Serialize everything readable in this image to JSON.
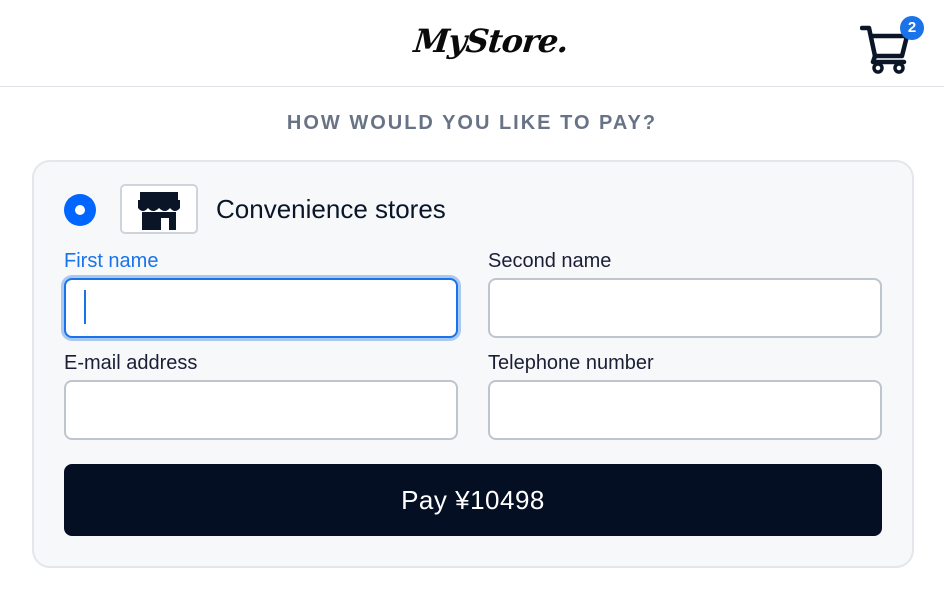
{
  "header": {
    "logo_text": "MyStore.",
    "cart_count": "2"
  },
  "page": {
    "heading": "HOW WOULD YOU LIKE TO PAY?"
  },
  "payment_method": {
    "label": "Convenience stores",
    "selected": true,
    "icon": "storefront-icon"
  },
  "form": {
    "first_name": {
      "label": "First name",
      "value": ""
    },
    "second_name": {
      "label": "Second name",
      "value": ""
    },
    "email": {
      "label": "E-mail address",
      "value": ""
    },
    "telephone": {
      "label": "Telephone number",
      "value": ""
    }
  },
  "pay_button": {
    "label": "Pay ¥10498"
  },
  "colors": {
    "accent": "#1a73e8",
    "radio": "#0066ff",
    "button": "#050f24",
    "heading": "#697386",
    "card_bg": "#f6f8fa"
  }
}
